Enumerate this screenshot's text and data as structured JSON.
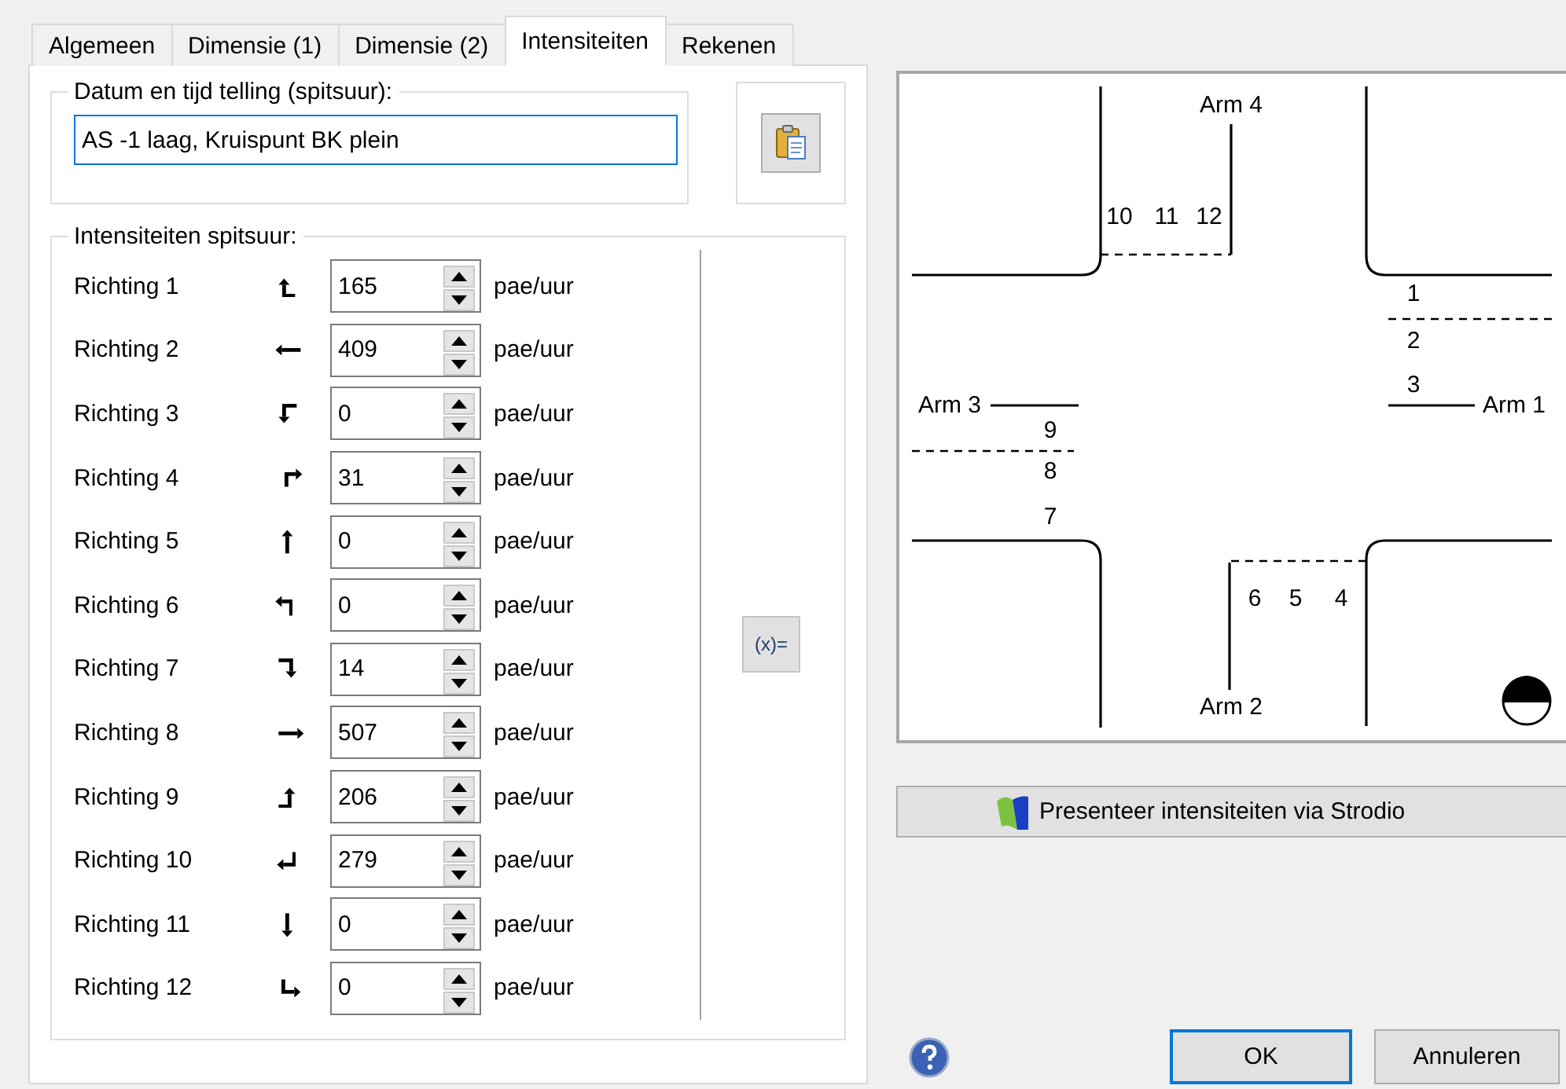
{
  "tabs": [
    {
      "label": "Algemeen",
      "selected": false
    },
    {
      "label": "Dimensie (1)",
      "selected": false
    },
    {
      "label": "Dimensie (2)",
      "selected": false
    },
    {
      "label": "Intensiteiten",
      "selected": true
    },
    {
      "label": "Rekenen",
      "selected": false
    }
  ],
  "count_group": {
    "label": "Datum en tijd telling (spitsuur):",
    "value": "AS -1 laag, Kruispunt BK plein"
  },
  "intensities_group": {
    "label": "Intensiteiten spitsuur:",
    "rows": [
      {
        "label": "Richting 1",
        "value": "165",
        "unit": "pae/uur"
      },
      {
        "label": "Richting 2",
        "value": "409",
        "unit": "pae/uur"
      },
      {
        "label": "Richting 3",
        "value": "0",
        "unit": "pae/uur"
      },
      {
        "label": "Richting 4",
        "value": "31",
        "unit": "pae/uur"
      },
      {
        "label": "Richting 5",
        "value": "0",
        "unit": "pae/uur"
      },
      {
        "label": "Richting 6",
        "value": "0",
        "unit": "pae/uur"
      },
      {
        "label": "Richting 7",
        "value": "14",
        "unit": "pae/uur"
      },
      {
        "label": "Richting 8",
        "value": "507",
        "unit": "pae/uur"
      },
      {
        "label": "Richting 9",
        "value": "206",
        "unit": "pae/uur"
      },
      {
        "label": "Richting 10",
        "value": "279",
        "unit": "pae/uur"
      },
      {
        "label": "Richting 11",
        "value": "0",
        "unit": "pae/uur"
      },
      {
        "label": "Richting 12",
        "value": "0",
        "unit": "pae/uur"
      }
    ],
    "formula_button": "(x)="
  },
  "diagram": {
    "arms": [
      "Arm 1",
      "Arm 2",
      "Arm 3",
      "Arm 4"
    ],
    "lanes": [
      "10",
      "11",
      "12",
      "1",
      "2",
      "3",
      "9",
      "8",
      "7",
      "6",
      "5",
      "4"
    ]
  },
  "strodio_button": "Presenteer intensiteiten via Strodio",
  "buttons": [
    {
      "label": "OK",
      "default": true
    },
    {
      "label": "Annuleren",
      "default": false
    }
  ]
}
